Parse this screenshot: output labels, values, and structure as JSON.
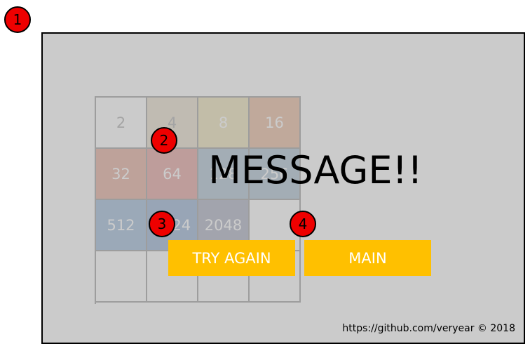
{
  "markers": [
    "1",
    "2",
    "3",
    "4"
  ],
  "board": {
    "tiles": [
      {
        "value": "2",
        "bg": "#ffffff",
        "fg": "#a9a9a9"
      },
      {
        "value": "4",
        "bg": "#e6dcc8",
        "fg": "#a9a9a9"
      },
      {
        "value": "8",
        "bg": "#ece0b2",
        "fg": "#ffffff"
      },
      {
        "value": "16",
        "bg": "#e6b496",
        "fg": "#ffffff"
      },
      {
        "value": "32",
        "bg": "#e3a492",
        "fg": "#ffffff"
      },
      {
        "value": "64",
        "bg": "#e39a96",
        "fg": "#ffffff"
      },
      {
        "value": "128",
        "bg": "#a6bcce",
        "fg": "#ffffff"
      },
      {
        "value": "256",
        "bg": "#a6bcce",
        "fg": "#ffffff"
      },
      {
        "value": "512",
        "bg": "#94b4d6",
        "fg": "#ffffff"
      },
      {
        "value": "1024",
        "bg": "#8eaad0",
        "fg": "#ffffff"
      },
      {
        "value": "2048",
        "bg": "#a4a8bc",
        "fg": "#ffffff"
      },
      {
        "value": "",
        "bg": "#ffffff",
        "fg": "#ffffff"
      },
      {
        "value": "",
        "bg": "#ffffff",
        "fg": "#ffffff"
      },
      {
        "value": "",
        "bg": "#ffffff",
        "fg": "#ffffff"
      },
      {
        "value": "",
        "bg": "#ffffff",
        "fg": "#ffffff"
      },
      {
        "value": "",
        "bg": "#ffffff",
        "fg": "#ffffff"
      }
    ]
  },
  "overlay": {
    "message": "MESSAGE!!",
    "try_again_label": "TRY AGAIN",
    "main_label": "MAIN",
    "button_color": "#ffc000"
  },
  "footer": {
    "credit": "https://github.com/veryear © 2018"
  }
}
